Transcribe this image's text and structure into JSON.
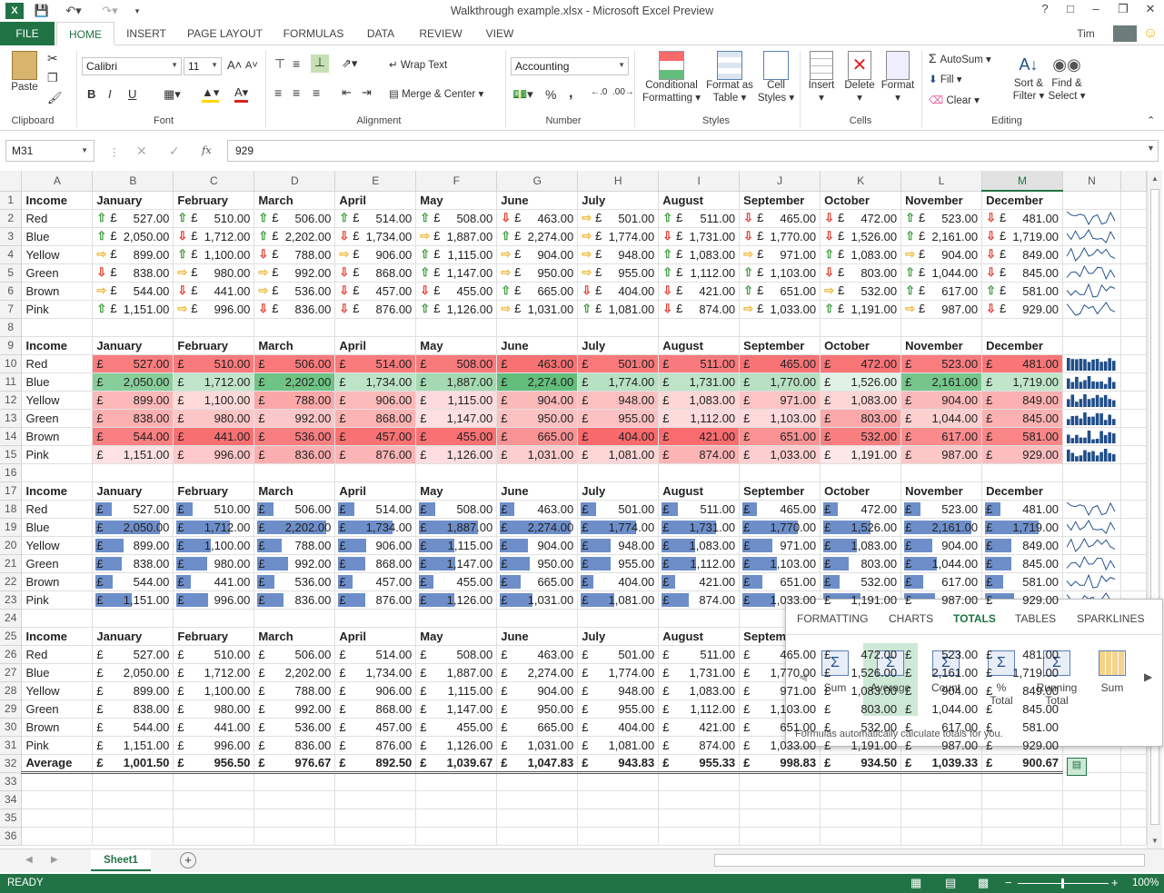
{
  "window": {
    "title": "Walkthrough example.xlsx - Microsoft Excel Preview",
    "user": "Tim",
    "help": "?"
  },
  "tabs": [
    "FILE",
    "HOME",
    "INSERT",
    "PAGE LAYOUT",
    "FORMULAS",
    "DATA",
    "REVIEW",
    "VIEW"
  ],
  "ribbon": {
    "clipboard": {
      "paste": "Paste",
      "label": "Clipboard"
    },
    "font": {
      "name": "Calibri",
      "size": "11",
      "label": "Font",
      "bold": "B",
      "italic": "I",
      "underline": "U"
    },
    "alignment": {
      "wrap": "Wrap Text",
      "merge": "Merge & Center",
      "label": "Alignment"
    },
    "number": {
      "format": "Accounting",
      "percent": "%",
      "comma": ",",
      "label": "Number"
    },
    "styles": {
      "cond1": "Conditional",
      "cond2": "Formatting",
      "fmt1": "Format as",
      "fmt2": "Table",
      "cell1": "Cell",
      "cell2": "Styles",
      "label": "Styles"
    },
    "cells": {
      "insert": "Insert",
      "delete": "Delete",
      "format": "Format",
      "label": "Cells"
    },
    "editing": {
      "autosum": "AutoSum",
      "fill": "Fill",
      "clear": "Clear",
      "sort1": "Sort &",
      "sort2": "Filter",
      "find1": "Find &",
      "find2": "Select",
      "label": "Editing"
    }
  },
  "formula_bar": {
    "cell": "M31",
    "fx": "fx",
    "value": "929"
  },
  "columns": [
    "A",
    "B",
    "C",
    "D",
    "E",
    "F",
    "G",
    "H",
    "I",
    "J",
    "K",
    "L",
    "M",
    "N"
  ],
  "months": [
    "January",
    "February",
    "March",
    "April",
    "May",
    "June",
    "July",
    "August",
    "September",
    "October",
    "November",
    "December"
  ],
  "header_label": "Income",
  "currency": "£",
  "rows": [
    {
      "name": "Red",
      "v": [
        "527.00",
        "510.00",
        "506.00",
        "514.00",
        "508.00",
        "463.00",
        "501.00",
        "511.00",
        "465.00",
        "472.00",
        "523.00",
        "481.00"
      ]
    },
    {
      "name": "Blue",
      "v": [
        "2,050.00",
        "1,712.00",
        "2,202.00",
        "1,734.00",
        "1,887.00",
        "2,274.00",
        "1,774.00",
        "1,731.00",
        "1,770.00",
        "1,526.00",
        "2,161.00",
        "1,719.00"
      ]
    },
    {
      "name": "Yellow",
      "v": [
        "899.00",
        "1,100.00",
        "788.00",
        "906.00",
        "1,115.00",
        "904.00",
        "948.00",
        "1,083.00",
        "971.00",
        "1,083.00",
        "904.00",
        "849.00"
      ]
    },
    {
      "name": "Green",
      "v": [
        "838.00",
        "980.00",
        "992.00",
        "868.00",
        "1,147.00",
        "950.00",
        "955.00",
        "1,112.00",
        "1,103.00",
        "803.00",
        "1,044.00",
        "845.00"
      ]
    },
    {
      "name": "Brown",
      "v": [
        "544.00",
        "441.00",
        "536.00",
        "457.00",
        "455.00",
        "665.00",
        "404.00",
        "421.00",
        "651.00",
        "532.00",
        "617.00",
        "581.00"
      ]
    },
    {
      "name": "Pink",
      "v": [
        "1,151.00",
        "996.00",
        "836.00",
        "876.00",
        "1,126.00",
        "1,031.00",
        "1,081.00",
        "874.00",
        "1,033.00",
        "1,191.00",
        "987.00",
        "929.00"
      ]
    }
  ],
  "average": {
    "label": "Average",
    "v": [
      "1,001.50",
      "956.50",
      "976.67",
      "892.50",
      "1,039.67",
      "1,047.83",
      "943.83",
      "955.33",
      "998.83",
      "934.50",
      "1,039.33",
      "900.67"
    ]
  },
  "quick_analysis": {
    "tabs": [
      "FORMATTING",
      "CHARTS",
      "TOTALS",
      "TABLES",
      "SPARKLINES"
    ],
    "items": [
      {
        "l1": "Sum",
        "l2": ""
      },
      {
        "l1": "Average",
        "l2": ""
      },
      {
        "l1": "Count",
        "l2": ""
      },
      {
        "l1": "%",
        "l2": "Total"
      },
      {
        "l1": "Running",
        "l2": "Total"
      },
      {
        "l1": "Sum",
        "l2": ""
      }
    ],
    "hint": "Formulas automatically calculate totals for you."
  },
  "sheet_tab": "Sheet1",
  "status": {
    "ready": "READY",
    "zoom": "100%"
  },
  "colors": {
    "green": "#217346",
    "red_fill": "#f8696b",
    "green_fill": "#63be7b",
    "bar": "#6d8ec9",
    "spark": "#1f4e8a"
  }
}
